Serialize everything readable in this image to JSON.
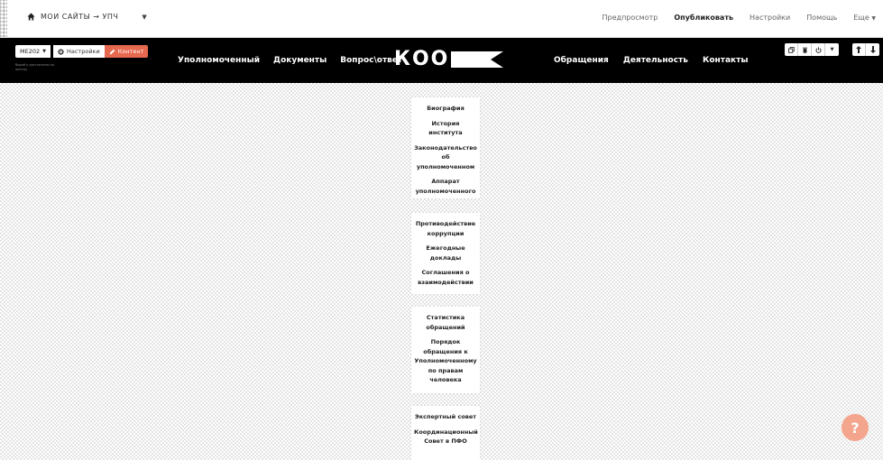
{
  "topbar": {
    "site_switcher": "МОИ САЙТЫ → УПЧ",
    "links": {
      "preview": "Предпросмотр",
      "publish": "Опубликовать",
      "settings": "Настройки",
      "help": "Помощь",
      "more": "Еще"
    }
  },
  "editor": {
    "version_label": "ME202",
    "settings_label": "Настройки",
    "content_label": "Контент",
    "note": "Ворой к растоплены по центру"
  },
  "nav": {
    "left": [
      "Уполномоченный",
      "Документы",
      "Вопрос\\ответ"
    ],
    "logo": "КОО",
    "right": [
      "Обращения",
      "Деятельность",
      "Контакты"
    ]
  },
  "menus": [
    [
      "Биография",
      "История института",
      "Законодательство об уполномоченном",
      "Аппарат уполномоченного"
    ],
    [
      "Противодействие коррупции",
      "Ежегодные доклады",
      "Соглашения о взаимодействии"
    ],
    [
      "Статистика обращений",
      "Порядок обращения к Уполномоченному по правам человека"
    ],
    [
      "Экспертный совет",
      "Координационный Совет в ПФО"
    ]
  ],
  "help_label": "?",
  "colors": {
    "accent": "#e6684e",
    "navbar": "#000000",
    "help_bubble": "#f4a58d"
  }
}
